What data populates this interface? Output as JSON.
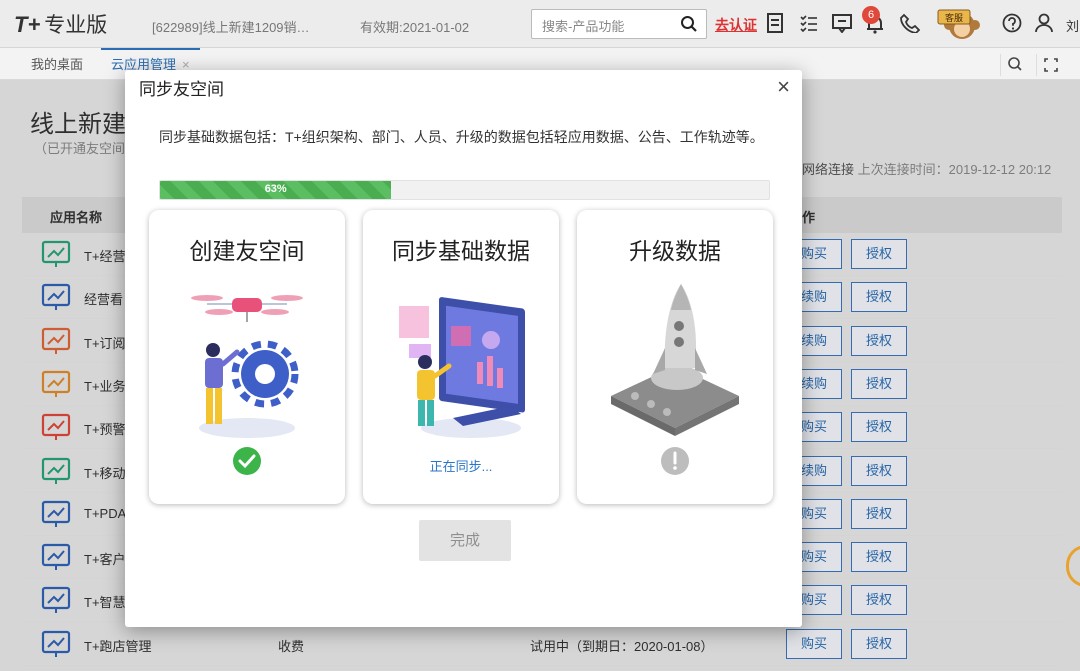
{
  "header": {
    "logo_mark": "T+",
    "logo_name": "专业版",
    "account": "[622989]线上新建1209销…",
    "expiry": "有效期:2021-01-02",
    "search_placeholder": "搜索-产品功能",
    "cert_link": "去认证",
    "notif_count": "6",
    "kefu_label": "客服",
    "username": "刘"
  },
  "tabs": [
    {
      "label": "我的桌面"
    },
    {
      "label": "云应用管理",
      "close": "×"
    }
  ],
  "page": {
    "title": "线上新建",
    "subtitle": "（已开通友空间",
    "net_status": "网络连接",
    "last_conn": "上次连接时间：2019-12-12 20:12",
    "col_app": "应用名称",
    "col_ops": "作"
  },
  "rows": [
    {
      "name": "T+经营",
      "icon": "chart-board-icon",
      "op1": "购买",
      "op2": "授权"
    },
    {
      "name": "经营看",
      "icon": "dashboard-icon",
      "op1": "续购",
      "op2": "授权"
    },
    {
      "name": "T+订阅",
      "icon": "subscribe-icon",
      "op1": "续购",
      "op2": "授权"
    },
    {
      "name": "T+业务",
      "icon": "business-icon",
      "op1": "续购",
      "op2": "授权"
    },
    {
      "name": "T+预警",
      "icon": "alert-bell-icon",
      "op1": "购买",
      "op2": "授权"
    },
    {
      "name": "T+移动",
      "icon": "mobile-yen-icon",
      "op1": "续购",
      "op2": "授权"
    },
    {
      "name": "T+PDA",
      "icon": "tag-icon",
      "op1": "购买",
      "op2": "授权"
    },
    {
      "name": "T+客户",
      "icon": "customer-icon",
      "op1": "购买",
      "op2": "授权"
    },
    {
      "name": "T+智慧",
      "icon": "smart-bag-icon",
      "op1": "购买",
      "op2": "授权"
    },
    {
      "name": "T+跑店管理",
      "icon": "store-manage-icon",
      "fee": "收费",
      "status": "试用中（到期日：2020-01-08）",
      "op1": "购买",
      "op2": "授权"
    }
  ],
  "modal": {
    "title": "同步友空间",
    "close": "×",
    "desc": "同步基础数据包括：T+组织架构、部门、人员、升级的数据包括轻应用数据、公告、工作轨迹等。",
    "progress_label": "63%",
    "progress_value": 0.38,
    "cards": [
      {
        "title": "创建友空间",
        "status_icon": "check-circle-icon"
      },
      {
        "title": "同步基础数据",
        "status_text": "正在同步..."
      },
      {
        "title": "升级数据",
        "status_icon": "warning-circle-icon"
      }
    ],
    "done_button": "完成"
  },
  "colors": {
    "accent": "#2a6db5",
    "progress": "#5cbe62",
    "success": "#3cb449",
    "pending": "#bdbdbd",
    "alert": "#e0483a"
  }
}
